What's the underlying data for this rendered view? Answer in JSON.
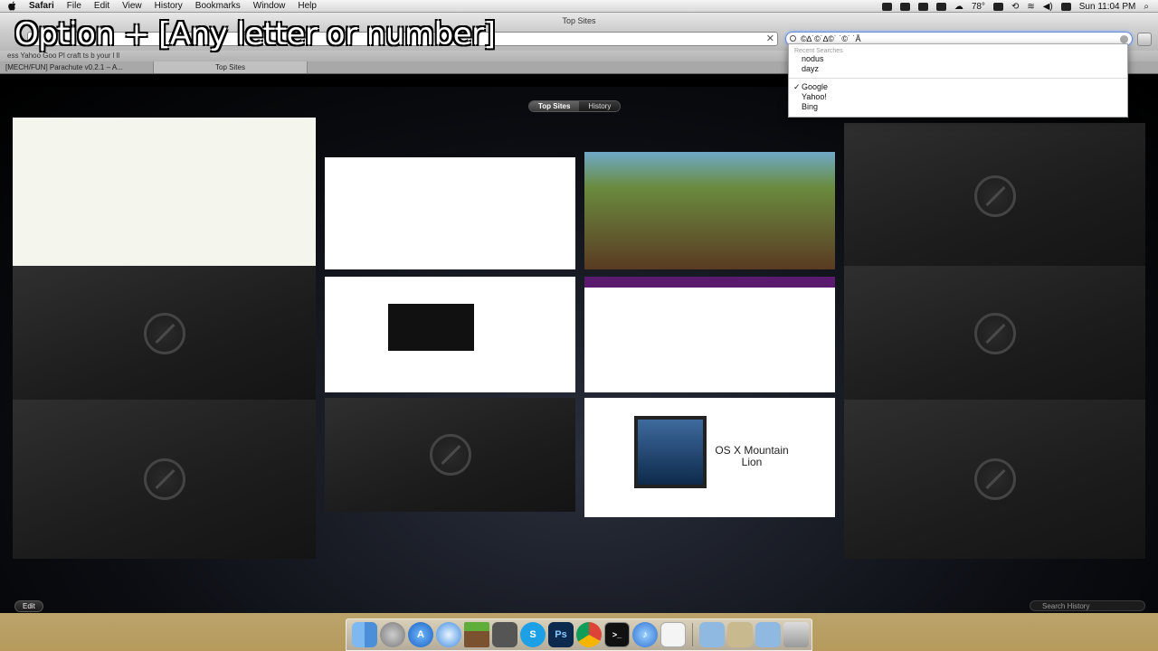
{
  "menubar": {
    "app": "Safari",
    "menus": [
      "File",
      "Edit",
      "View",
      "History",
      "Bookmarks",
      "Window",
      "Help"
    ],
    "temperature": "78°",
    "clock": "Sun 11:04 PM"
  },
  "window": {
    "title": "Top Sites",
    "search_field_value": "©∆˙©˙∆©˙ ˙©˙ ˙Å",
    "tabs": [
      "[MECH/FUN] Parachute v0.2.1 – A...",
      "Top Sites"
    ],
    "bookmarks_bar_text": "ess    Yahoo   Goo     Pl       craft              ts         b       your l      ll"
  },
  "caption": "Option + [Any letter or number]",
  "topsites": {
    "segments": [
      "Top Sites",
      "History"
    ],
    "edit_label": "Edit",
    "search_history_placeholder": "Search History",
    "mountain_lion_title": "OS X Mountain Lion"
  },
  "search_dropdown": {
    "header": "Recent Searches",
    "recent": [
      "nodus",
      "dayz"
    ],
    "engines": [
      "Google",
      "Yahoo!",
      "Bing"
    ],
    "selected_engine": "Google"
  },
  "dock": {
    "apps": [
      "Finder",
      "Launchpad",
      "App Store",
      "Safari",
      "Minecraft",
      "Photos",
      "Skype",
      "Photoshop",
      "Chrome",
      "Terminal",
      "iTunes",
      "Preview",
      "Documents",
      "Downloads",
      "Applications",
      "Trash"
    ]
  }
}
